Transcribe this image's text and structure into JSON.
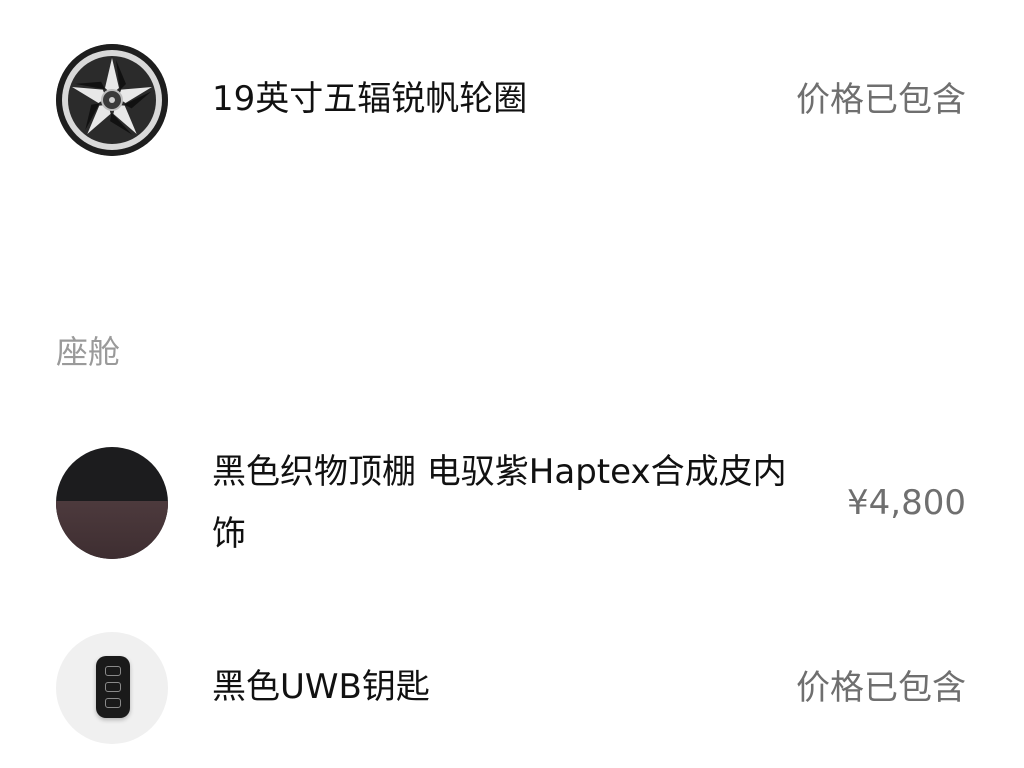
{
  "items": [
    {
      "name": "19英寸五辐锐帆轮圈",
      "price": "价格已包含",
      "image_icon": "wheel-icon"
    },
    {
      "name": "黑色织物顶棚 电驭紫Haptex合成皮内饰",
      "price": "¥4,800",
      "image_icon": "interior-swatch-icon"
    },
    {
      "name": "黑色UWB钥匙",
      "price": "价格已包含",
      "image_icon": "key-icon"
    }
  ],
  "section": {
    "cabin_title": "座舱"
  },
  "colors": {
    "text_primary": "#111111",
    "text_secondary": "#6f6f6f",
    "section_title": "#9a9a9a",
    "interior_upper": "#1c1c1e",
    "interior_lower": "#4d3a3d"
  }
}
